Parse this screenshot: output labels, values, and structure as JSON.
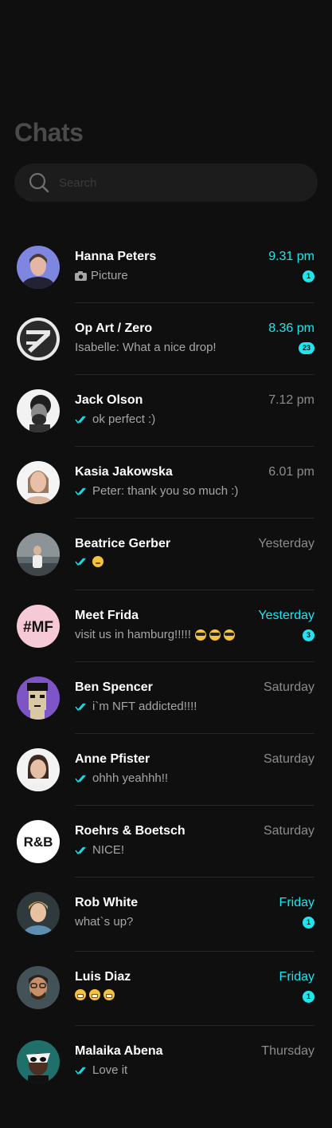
{
  "header": {
    "title": "Chats"
  },
  "search": {
    "placeholder": "Search",
    "icon": "search-icon"
  },
  "colors": {
    "accent": "#1de6f0",
    "background": "#0f0f0f"
  },
  "chats": [
    {
      "name": "Hanna Peters",
      "preview": "Picture",
      "preview_icon": "camera-icon",
      "time": "9.31 pm",
      "unread": "1",
      "time_accent": true
    },
    {
      "name": "Op Art / Zero",
      "preview": "Isabelle: What a nice drop!",
      "time": "8.36 pm",
      "unread": "23",
      "time_accent": true
    },
    {
      "name": "Jack Olson",
      "preview": "ok perfect :)",
      "preview_icon": "double-check-icon",
      "time": "7.12 pm"
    },
    {
      "name": "Kasia Jakowska",
      "preview": "Peter: thank you so much :)",
      "preview_icon": "double-check-icon",
      "time": "6.01 pm"
    },
    {
      "name": "Beatrice Gerber",
      "preview": "",
      "preview_icon": "double-check-icon",
      "preview_emoji": [
        "smirk-emoji"
      ],
      "time": "Yesterday"
    },
    {
      "name": "Meet Frida",
      "preview": "visit us in hamburg!!!!!",
      "preview_emoji": [
        "sunglasses-emoji",
        "sunglasses-emoji",
        "sunglasses-emoji"
      ],
      "time": "Yesterday",
      "unread": "3",
      "time_accent": true,
      "avatar_text": "#MF"
    },
    {
      "name": "Ben Spencer",
      "preview": "i`m NFT addicted!!!!",
      "preview_icon": "double-check-icon",
      "time": "Saturday"
    },
    {
      "name": "Anne Pfister",
      "preview": "ohhh yeahhh!!",
      "preview_icon": "double-check-icon",
      "time": "Saturday"
    },
    {
      "name": "Roehrs & Boetsch",
      "preview": "NICE!",
      "preview_icon": "double-check-icon",
      "time": "Saturday",
      "avatar_text": "R&B"
    },
    {
      "name": "Rob White",
      "preview": "what`s up?",
      "time": "Friday",
      "unread": "1",
      "time_accent": true
    },
    {
      "name": "Luis Diaz",
      "preview": "",
      "preview_emoji": [
        "grin-emoji",
        "grin-emoji",
        "grin-emoji"
      ],
      "time": "Friday",
      "unread": "1",
      "time_accent": true
    },
    {
      "name": "Malaika Abena",
      "preview": "Love it",
      "preview_icon": "double-check-icon",
      "time": "Thursday"
    }
  ]
}
